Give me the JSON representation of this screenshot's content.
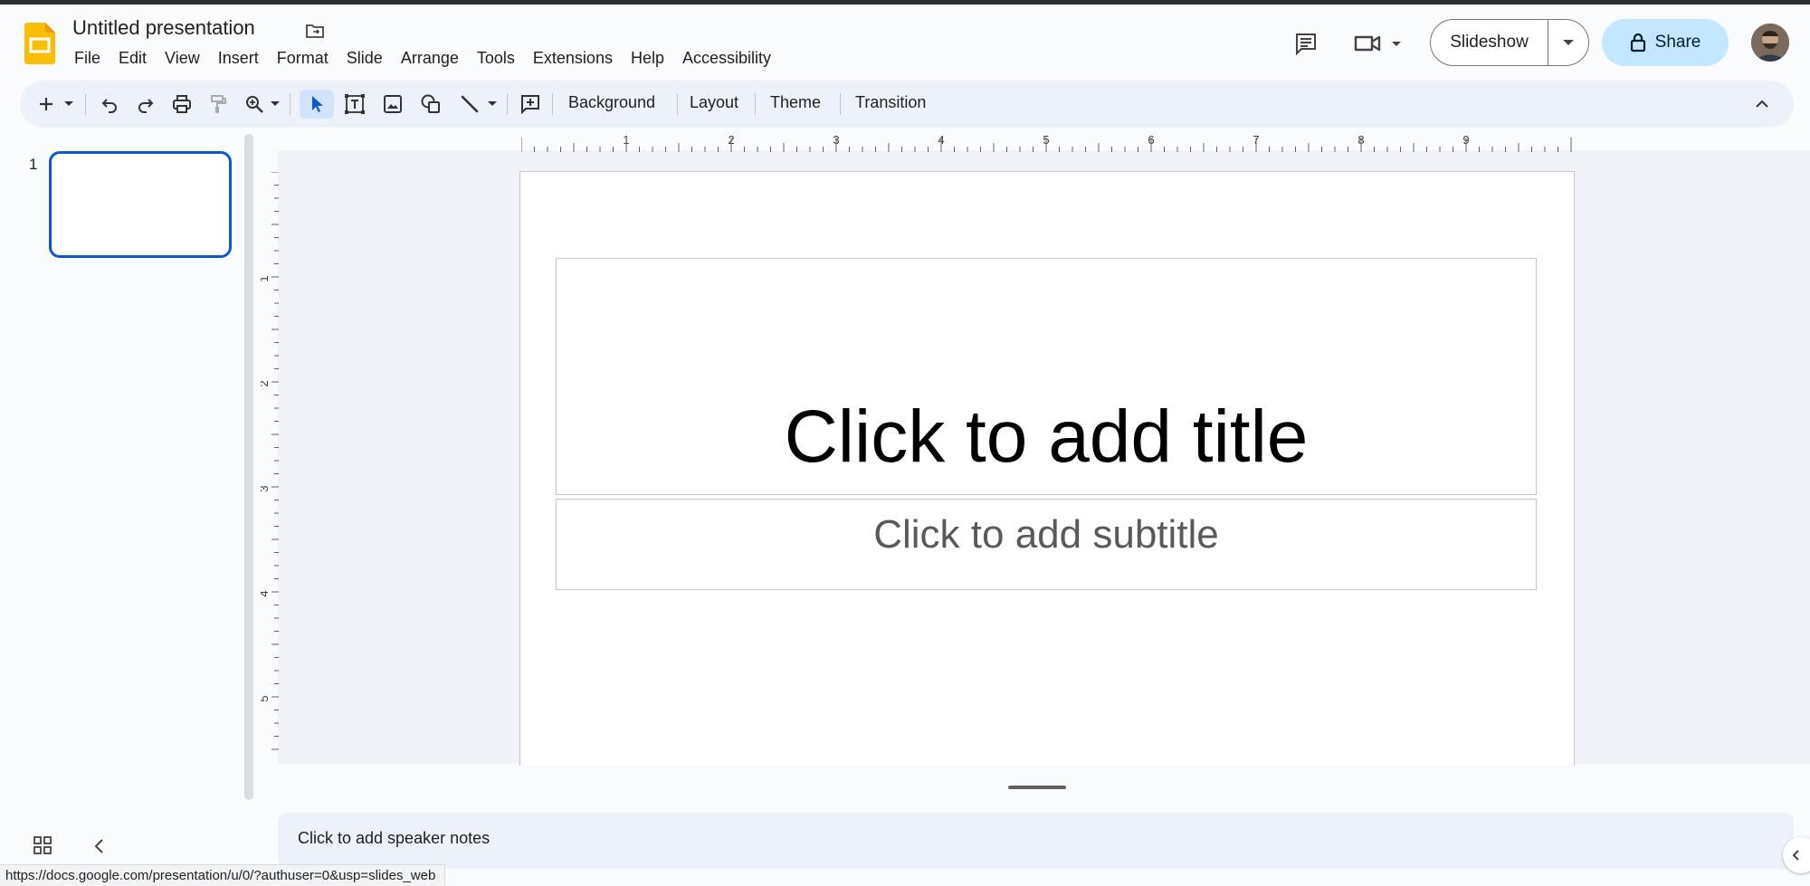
{
  "app": {
    "doc_title": "Untitled presentation"
  },
  "menu": [
    "File",
    "Edit",
    "View",
    "Insert",
    "Format",
    "Slide",
    "Arrange",
    "Tools",
    "Extensions",
    "Help",
    "Accessibility"
  ],
  "header": {
    "slideshow_label": "Slideshow",
    "share_label": "Share"
  },
  "toolbar": {
    "background": "Background",
    "layout": "Layout",
    "theme": "Theme",
    "transition": "Transition"
  },
  "ruler": {
    "horizontal": [
      "1",
      "2",
      "3",
      "4",
      "5",
      "6",
      "7",
      "8",
      "9"
    ],
    "vertical": [
      "1",
      "2",
      "3",
      "4",
      "5"
    ]
  },
  "filmstrip": {
    "slide_number": "1"
  },
  "slide": {
    "title_placeholder": "Click to add title",
    "subtitle_placeholder": "Click to add subtitle"
  },
  "notes": {
    "placeholder": "Click to add speaker notes"
  },
  "status": {
    "url": "https://docs.google.com/presentation/u/0/?authuser=0&usp=slides_web"
  },
  "colors": {
    "accent": "#0b57d0",
    "share_bg": "#c2e7ff",
    "toolbar_bg": "#edf2fa",
    "logo_yellow": "#fbbc04"
  }
}
